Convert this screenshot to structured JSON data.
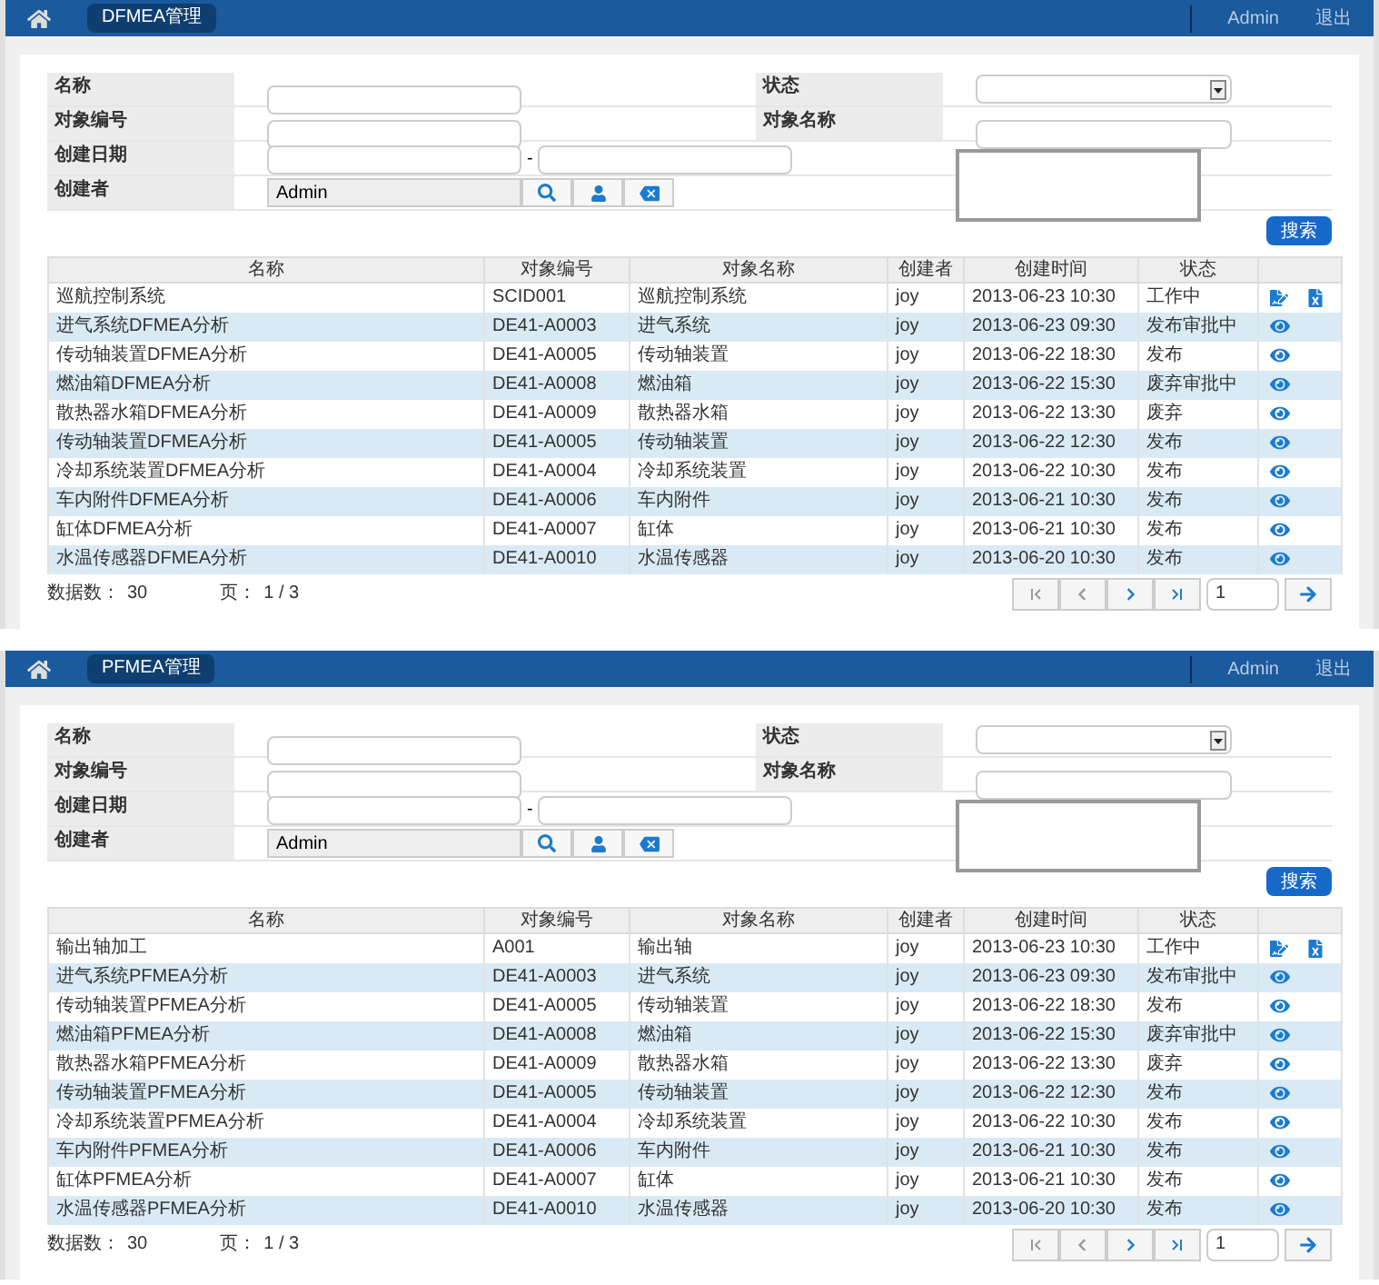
{
  "panels": [
    {
      "module": "DFMEA管理",
      "user": "Admin",
      "logout": "退出",
      "form": {
        "name_label": "名称",
        "status_label": "状态",
        "code_label": "对象编号",
        "object_label": "对象名称",
        "date_label": "创建日期",
        "date_sep": "-",
        "creator_label": "创建者",
        "creator_value": "Admin"
      },
      "search_button": "搜索",
      "columns": [
        "名称",
        "对象编号",
        "对象名称",
        "创建者",
        "创建时间",
        "状态"
      ],
      "rows": [
        {
          "kind": "edit",
          "cells": [
            "巡航控制系统",
            "SCID001",
            "巡航控制系统",
            "joy",
            "2013-06-23 10:30",
            "工作中"
          ]
        },
        {
          "kind": "view",
          "cells": [
            "进气系统DFMEA分析",
            "DE41-A0003",
            "进气系统",
            "joy",
            "2013-06-23 09:30",
            "发布审批中"
          ]
        },
        {
          "kind": "view",
          "cells": [
            "传动轴装置DFMEA分析",
            "DE41-A0005",
            "传动轴装置",
            "joy",
            "2013-06-22 18:30",
            "发布"
          ]
        },
        {
          "kind": "view",
          "cells": [
            "燃油箱DFMEA分析",
            "DE41-A0008",
            "燃油箱",
            "joy",
            "2013-06-22 15:30",
            "废弃审批中"
          ]
        },
        {
          "kind": "view",
          "cells": [
            "散热器水箱DFMEA分析",
            "DE41-A0009",
            "散热器水箱",
            "joy",
            "2013-06-22 13:30",
            "废弃"
          ]
        },
        {
          "kind": "view",
          "cells": [
            "传动轴装置DFMEA分析",
            "DE41-A0005",
            "传动轴装置",
            "joy",
            "2013-06-22 12:30",
            "发布"
          ]
        },
        {
          "kind": "view",
          "cells": [
            "冷却系统装置DFMEA分析",
            "DE41-A0004",
            "冷却系统装置",
            "joy",
            "2013-06-22 10:30",
            "发布"
          ]
        },
        {
          "kind": "view",
          "cells": [
            "车内附件DFMEA分析",
            "DE41-A0006",
            "车内附件",
            "joy",
            "2013-06-21 10:30",
            "发布"
          ]
        },
        {
          "kind": "view",
          "cells": [
            "缸体DFMEA分析",
            "DE41-A0007",
            "缸体",
            "joy",
            "2013-06-21 10:30",
            "发布"
          ]
        },
        {
          "kind": "view",
          "cells": [
            "水温传感器DFMEA分析",
            "DE41-A0010",
            "水温传感器",
            "joy",
            "2013-06-20 10:30",
            "发布"
          ]
        }
      ],
      "count_label": "数据数：",
      "count": "30",
      "page_label": "页：",
      "page": "1 / 3",
      "page_input": "1"
    },
    {
      "module": "PFMEA管理",
      "user": "Admin",
      "logout": "退出",
      "form": {
        "name_label": "名称",
        "status_label": "状态",
        "code_label": "对象编号",
        "object_label": "对象名称",
        "date_label": "创建日期",
        "date_sep": "-",
        "creator_label": "创建者",
        "creator_value": "Admin"
      },
      "search_button": "搜索",
      "columns": [
        "名称",
        "对象编号",
        "对象名称",
        "创建者",
        "创建时间",
        "状态"
      ],
      "rows": [
        {
          "kind": "edit",
          "cells": [
            "输出轴加工",
            "A001",
            "输出轴",
            "joy",
            "2013-06-23 10:30",
            "工作中"
          ]
        },
        {
          "kind": "view",
          "cells": [
            "进气系统PFMEA分析",
            "DE41-A0003",
            "进气系统",
            "joy",
            "2013-06-23 09:30",
            "发布审批中"
          ]
        },
        {
          "kind": "view",
          "cells": [
            "传动轴装置PFMEA分析",
            "DE41-A0005",
            "传动轴装置",
            "joy",
            "2013-06-22 18:30",
            "发布"
          ]
        },
        {
          "kind": "view",
          "cells": [
            "燃油箱PFMEA分析",
            "DE41-A0008",
            "燃油箱",
            "joy",
            "2013-06-22 15:30",
            "废弃审批中"
          ]
        },
        {
          "kind": "view",
          "cells": [
            "散热器水箱PFMEA分析",
            "DE41-A0009",
            "散热器水箱",
            "joy",
            "2013-06-22 13:30",
            "废弃"
          ]
        },
        {
          "kind": "view",
          "cells": [
            "传动轴装置PFMEA分析",
            "DE41-A0005",
            "传动轴装置",
            "joy",
            "2013-06-22 12:30",
            "发布"
          ]
        },
        {
          "kind": "view",
          "cells": [
            "冷却系统装置PFMEA分析",
            "DE41-A0004",
            "冷却系统装置",
            "joy",
            "2013-06-22 10:30",
            "发布"
          ]
        },
        {
          "kind": "view",
          "cells": [
            "车内附件PFMEA分析",
            "DE41-A0006",
            "车内附件",
            "joy",
            "2013-06-21 10:30",
            "发布"
          ]
        },
        {
          "kind": "view",
          "cells": [
            "缸体PFMEA分析",
            "DE41-A0007",
            "缸体",
            "joy",
            "2013-06-21 10:30",
            "发布"
          ]
        },
        {
          "kind": "view",
          "cells": [
            "水温传感器PFMEA分析",
            "DE41-A0010",
            "水温传感器",
            "joy",
            "2013-06-20 10:30",
            "发布"
          ]
        }
      ],
      "count_label": "数据数：",
      "count": "30",
      "page_label": "页：",
      "page": "1 / 3",
      "page_input": "1"
    }
  ]
}
